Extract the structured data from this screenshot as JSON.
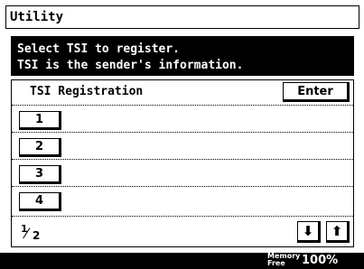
{
  "title": "Utility",
  "message": {
    "line1": "Select TSI to register.",
    "line2": "TSI is the sender's information."
  },
  "panel": {
    "header": "TSI Registration",
    "enter_label": "Enter",
    "items": [
      "1",
      "2",
      "3",
      "4"
    ],
    "page": {
      "current": "1",
      "total": "2"
    },
    "down_icon": "arrow-down-icon",
    "up_icon": "arrow-up-icon",
    "down_glyph": "⬇",
    "up_glyph": "⬆"
  },
  "status": {
    "memory_label_1": "Memory",
    "memory_label_2": "Free",
    "memory_value": "100%"
  }
}
